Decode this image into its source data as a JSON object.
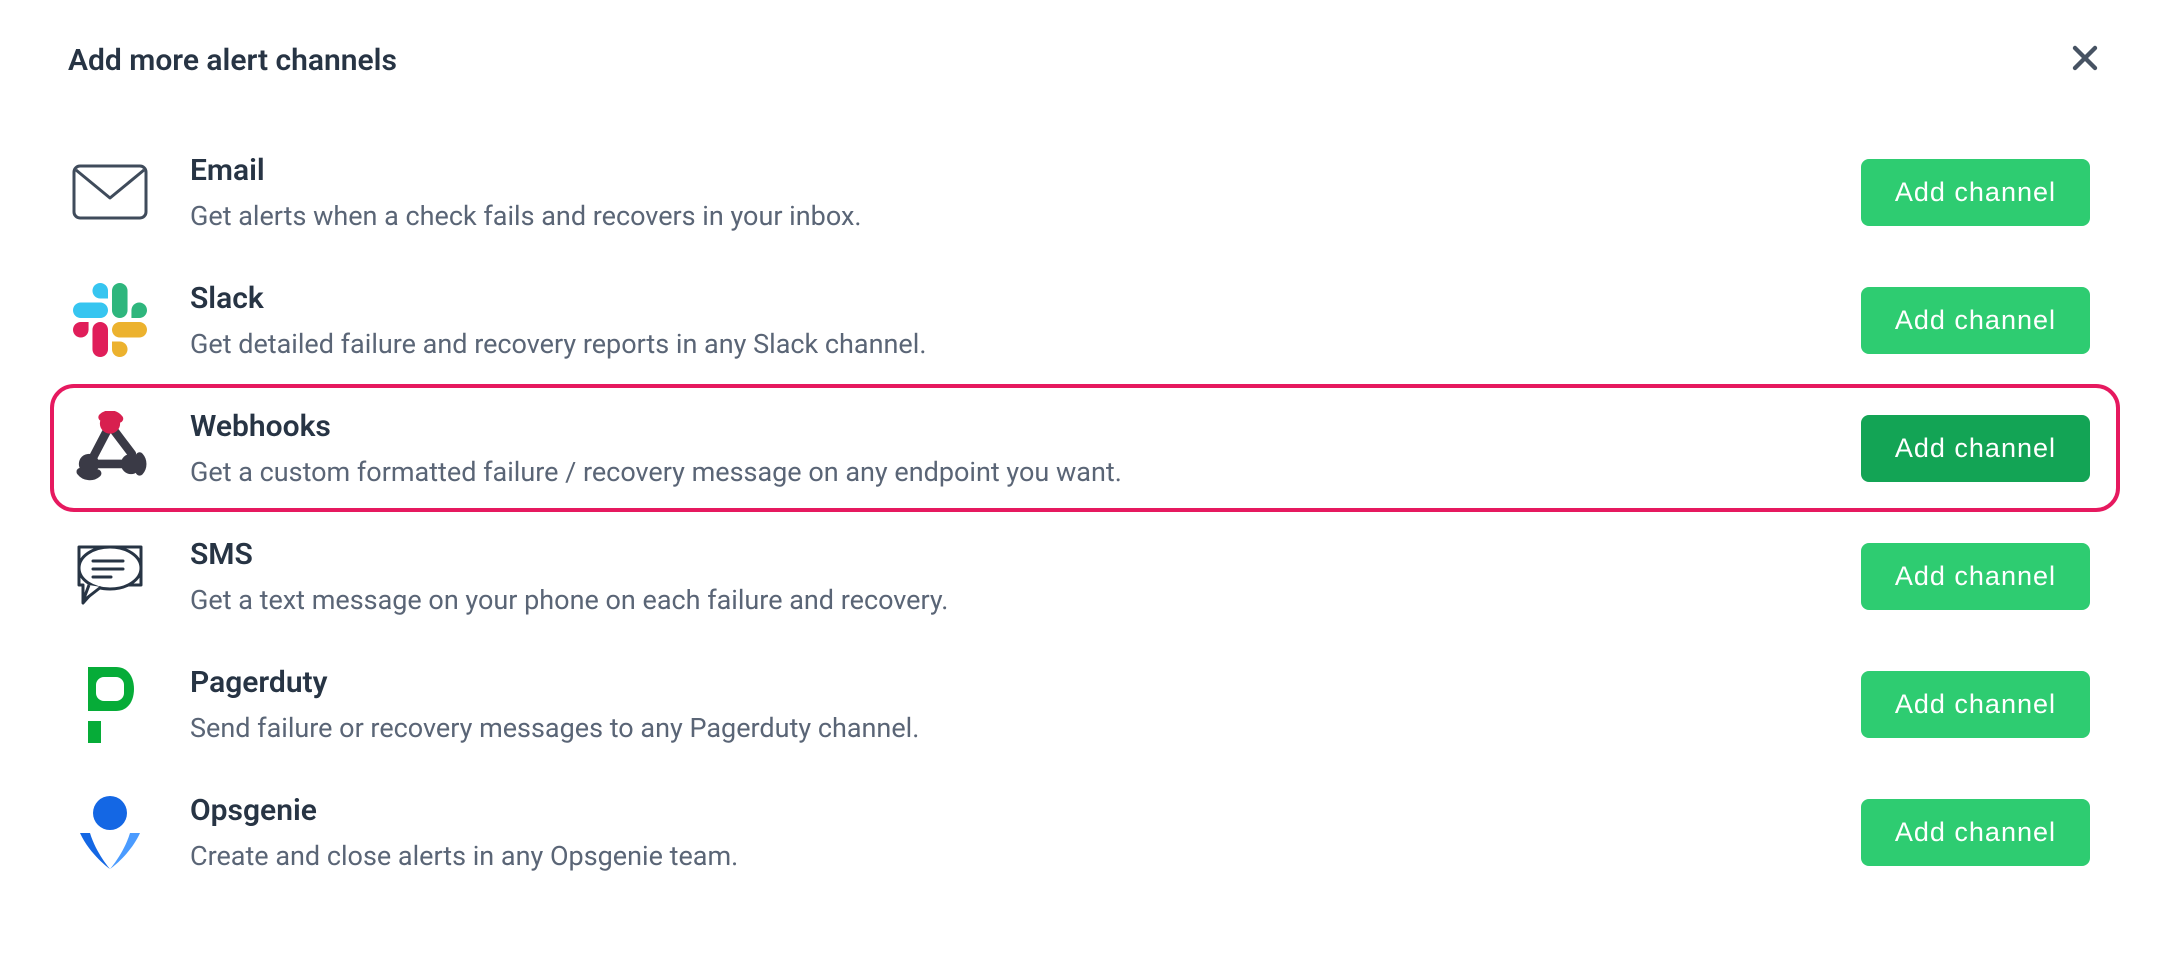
{
  "title": "Add more alert channels",
  "add_label": "Add channel",
  "channels": [
    {
      "id": "email",
      "title": "Email",
      "desc": "Get alerts when a check fails and recovers in your inbox.",
      "highlight": false,
      "button_active": false
    },
    {
      "id": "slack",
      "title": "Slack",
      "desc": "Get detailed failure and recovery reports in any Slack channel.",
      "highlight": false,
      "button_active": false
    },
    {
      "id": "webhooks",
      "title": "Webhooks",
      "desc": "Get a custom formatted failure / recovery message on any endpoint you want.",
      "highlight": true,
      "button_active": true
    },
    {
      "id": "sms",
      "title": "SMS",
      "desc": "Get a text message on your phone on each failure and recovery.",
      "highlight": false,
      "button_active": false
    },
    {
      "id": "pagerduty",
      "title": "Pagerduty",
      "desc": "Send failure or recovery messages to any Pagerduty channel.",
      "highlight": false,
      "button_active": false
    },
    {
      "id": "opsgenie",
      "title": "Opsgenie",
      "desc": "Create and close alerts in any Opsgenie team.",
      "highlight": false,
      "button_active": false
    }
  ]
}
